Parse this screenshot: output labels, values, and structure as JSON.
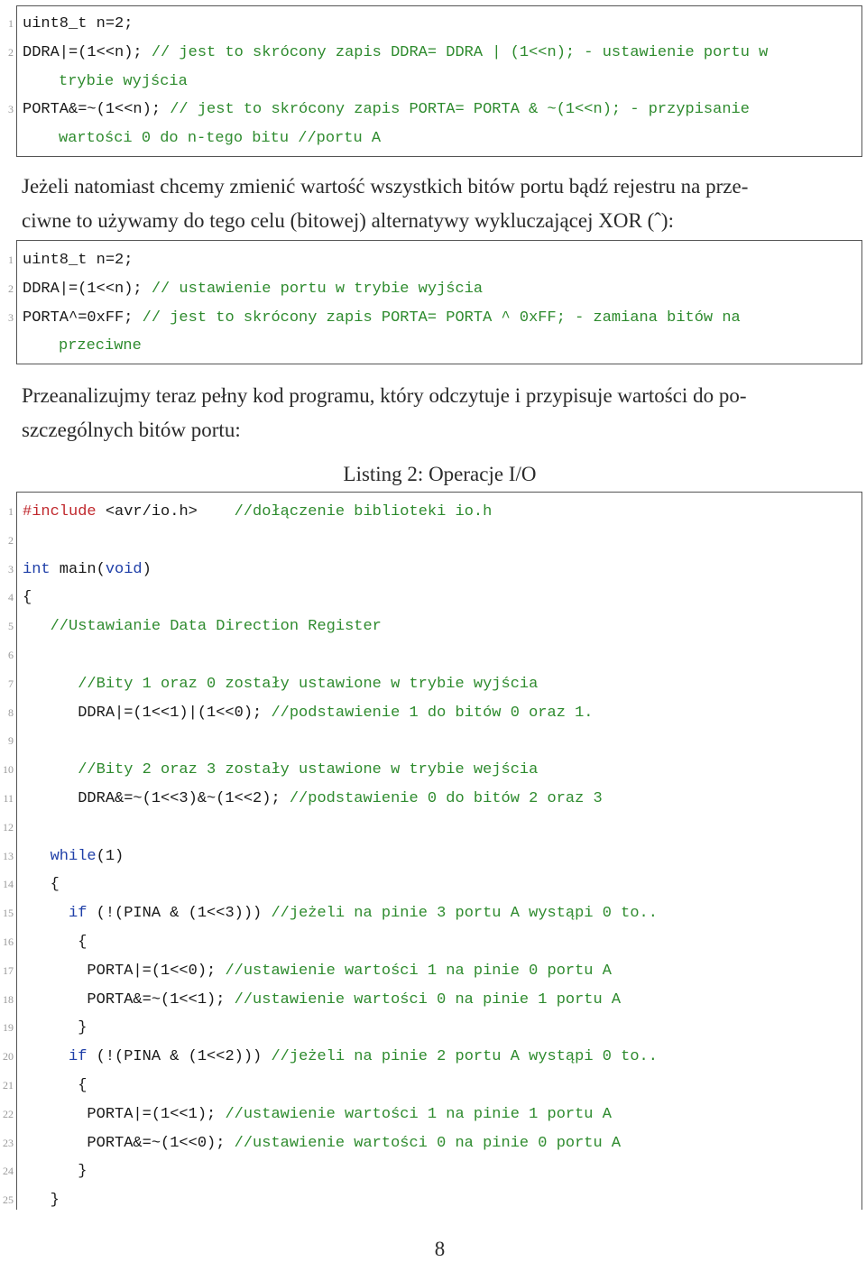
{
  "listing1": {
    "lines": [
      {
        "no": "1",
        "code": "uint8_t n=2;",
        "comment": ""
      },
      {
        "no": "2",
        "code": "DDRA|=(1<<n); ",
        "comment": "// jest to skrócony zapis DDRA= DDRA | (1<<n); - ustawienie portu w"
      },
      {
        "no": "",
        "code": "",
        "comment": "trybie wyjścia",
        "cont": true
      },
      {
        "no": "3",
        "code": "PORTA&=~(1<<n); ",
        "comment": "// jest to skrócony zapis PORTA= PORTA & ~(1<<n); - przypisanie"
      },
      {
        "no": "",
        "code": "",
        "comment": "wartości 0 do n-tego bitu //portu A",
        "cont": true
      }
    ]
  },
  "paragraph1": "Jeżeli natomiast chcemy zmienić wartość wszystkich bitów portu bądź rejestru na prze-ciwne to używamy do tego celu (bitowej) alternatywy wykluczającej XOR (ˆ):",
  "paragraph1_lines": [
    "Jeżeli natomiast chcemy zmienić wartość wszystkich bitów portu bądź rejestru na prze-",
    "ciwne to używamy do tego celu (bitowej) alternatywy wykluczającej XOR (ˆ):"
  ],
  "listing2": {
    "lines": [
      {
        "no": "1",
        "code": "uint8_t n=2;",
        "comment": ""
      },
      {
        "no": "2",
        "code": "DDRA|=(1<<n); ",
        "comment": "// ustawienie portu w trybie wyjścia"
      },
      {
        "no": "3",
        "code": "PORTA^=0xFF; ",
        "comment": "// jest to skrócony zapis PORTA= PORTA ^ 0xFF; - zamiana bitów na"
      },
      {
        "no": "",
        "code": "",
        "comment": "przeciwne",
        "cont": true
      }
    ]
  },
  "paragraph2_lines": [
    "Przeanalizujmy teraz pełny kod programu, który odczytuje i przypisuje wartości do po-",
    "szczególnych bitów portu:"
  ],
  "listing3": {
    "caption": "Listing 2: Operacje I/O",
    "lines": [
      {
        "no": "1",
        "parts": [
          {
            "t": "#include",
            "c": "pp"
          },
          {
            "t": " <avr/io.h>    ",
            "c": ""
          },
          {
            "t": "//dołączenie biblioteki io.h",
            "c": "cm"
          }
        ]
      },
      {
        "no": "2",
        "parts": []
      },
      {
        "no": "3",
        "parts": [
          {
            "t": "int",
            "c": "kw"
          },
          {
            "t": " main(",
            "c": ""
          },
          {
            "t": "void",
            "c": "kw"
          },
          {
            "t": ")",
            "c": ""
          }
        ]
      },
      {
        "no": "4",
        "parts": [
          {
            "t": "{",
            "c": ""
          }
        ]
      },
      {
        "no": "5",
        "parts": [
          {
            "t": "   ",
            "c": ""
          },
          {
            "t": "//Ustawianie Data Direction Register",
            "c": "cm"
          }
        ]
      },
      {
        "no": "6",
        "parts": []
      },
      {
        "no": "7",
        "parts": [
          {
            "t": "      ",
            "c": ""
          },
          {
            "t": "//Bity 1 oraz 0 zostały ustawione w trybie wyjścia",
            "c": "cm"
          }
        ]
      },
      {
        "no": "8",
        "parts": [
          {
            "t": "      DDRA|=(1<<1)|(1<<0); ",
            "c": ""
          },
          {
            "t": "//podstawienie 1 do bitów 0 oraz 1.",
            "c": "cm"
          }
        ]
      },
      {
        "no": "9",
        "parts": []
      },
      {
        "no": "10",
        "parts": [
          {
            "t": "      ",
            "c": ""
          },
          {
            "t": "//Bity 2 oraz 3 zostały ustawione w trybie wejścia",
            "c": "cm"
          }
        ]
      },
      {
        "no": "11",
        "parts": [
          {
            "t": "      DDRA&=~(1<<3)&~(1<<2); ",
            "c": ""
          },
          {
            "t": "//podstawienie 0 do bitów 2 oraz 3",
            "c": "cm"
          }
        ]
      },
      {
        "no": "12",
        "parts": []
      },
      {
        "no": "13",
        "parts": [
          {
            "t": "   ",
            "c": ""
          },
          {
            "t": "while",
            "c": "kw"
          },
          {
            "t": "(1)",
            "c": ""
          }
        ]
      },
      {
        "no": "14",
        "parts": [
          {
            "t": "   {",
            "c": ""
          }
        ]
      },
      {
        "no": "15",
        "parts": [
          {
            "t": "     ",
            "c": ""
          },
          {
            "t": "if",
            "c": "kw"
          },
          {
            "t": " (!(PINA & (1<<3))) ",
            "c": ""
          },
          {
            "t": "//jeżeli na pinie 3 portu A wystąpi 0 to..",
            "c": "cm"
          }
        ]
      },
      {
        "no": "16",
        "parts": [
          {
            "t": "      {",
            "c": ""
          }
        ]
      },
      {
        "no": "17",
        "parts": [
          {
            "t": "       PORTA|=(1<<0); ",
            "c": ""
          },
          {
            "t": "//ustawienie wartości 1 na pinie 0 portu A",
            "c": "cm"
          }
        ]
      },
      {
        "no": "18",
        "parts": [
          {
            "t": "       PORTA&=~(1<<1); ",
            "c": ""
          },
          {
            "t": "//ustawienie wartości 0 na pinie 1 portu A",
            "c": "cm"
          }
        ]
      },
      {
        "no": "19",
        "parts": [
          {
            "t": "      }",
            "c": ""
          }
        ]
      },
      {
        "no": "20",
        "parts": [
          {
            "t": "     ",
            "c": ""
          },
          {
            "t": "if",
            "c": "kw"
          },
          {
            "t": " (!(PINA & (1<<2))) ",
            "c": ""
          },
          {
            "t": "//jeżeli na pinie 2 portu A wystąpi 0 to..",
            "c": "cm"
          }
        ]
      },
      {
        "no": "21",
        "parts": [
          {
            "t": "      {",
            "c": ""
          }
        ]
      },
      {
        "no": "22",
        "parts": [
          {
            "t": "       PORTA|=(1<<1); ",
            "c": ""
          },
          {
            "t": "//ustawienie wartości 1 na pinie 1 portu A",
            "c": "cm"
          }
        ]
      },
      {
        "no": "23",
        "parts": [
          {
            "t": "       PORTA&=~(1<<0); ",
            "c": ""
          },
          {
            "t": "//ustawienie wartości 0 na pinie 0 portu A",
            "c": "cm"
          }
        ]
      },
      {
        "no": "24",
        "parts": [
          {
            "t": "      }",
            "c": ""
          }
        ]
      },
      {
        "no": "25",
        "parts": [
          {
            "t": "   }",
            "c": ""
          }
        ]
      }
    ]
  },
  "page_number": "8",
  "colors": {
    "comment": "#2e8b2e",
    "keyword": "#1f3fa8",
    "preprocessor": "#c0282d",
    "line_number": "#9a9a9a",
    "frame": "#555555"
  }
}
